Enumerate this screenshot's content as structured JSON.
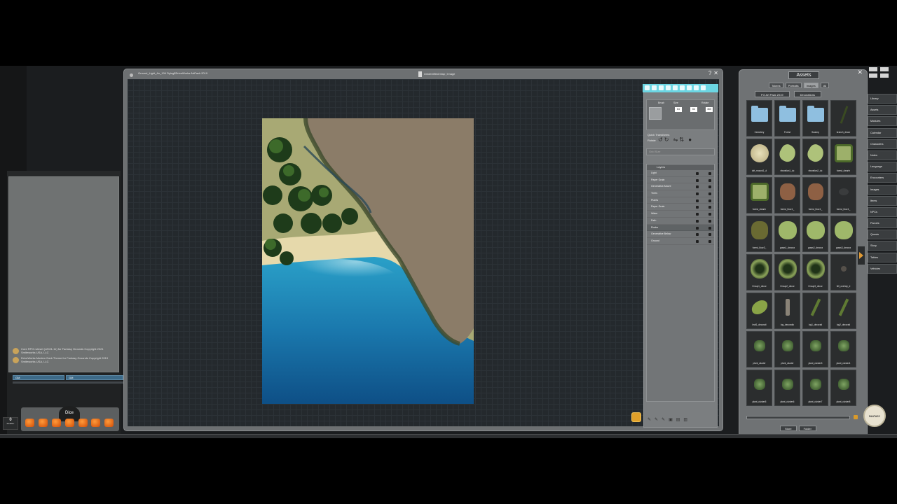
{
  "image_window": {
    "path": "Ground_Light_Ax_104 Dying$DriveWorks ArtPack 2019",
    "name": "Unidentified Map | Image",
    "buttons": [
      "?",
      "✕"
    ]
  },
  "chat": {
    "messages": [
      "Core RPG ruleset (v2021-11) for Fantasy Grounds Copyright 2021 Smiteworks USA, LLC",
      "DriveWorks Modern Dark Theme for Fantasy Grounds Copyright 2019 Smiteworks USA, LLC"
    ],
    "input_left": "GM",
    "input_right": "GM"
  },
  "modifier": {
    "value": "0",
    "label": "Modifier"
  },
  "dice_logo": "Dice",
  "tools": {
    "brush_label": "Brush",
    "size_label": "Size",
    "rotate_label": "Rotate",
    "size_value": "64",
    "size_value2": "64",
    "rotate_value": "360",
    "quick_transforms": "Quick Transforms",
    "rotate_row": "Rotate",
    "flip_label": "Flip",
    "reset_label": "Reset",
    "search_placeholder": "Grid Size",
    "layers_title": "Layers"
  },
  "layers": [
    {
      "name": "Light",
      "selected": false
    },
    {
      "name": "Paper Grain",
      "selected": false
    },
    {
      "name": "Generative Above",
      "selected": false
    },
    {
      "name": "Trees",
      "selected": false
    },
    {
      "name": "Plants",
      "selected": false
    },
    {
      "name": "Paper Grain",
      "selected": false
    },
    {
      "name": "Water",
      "selected": false
    },
    {
      "name": "Path",
      "selected": false
    },
    {
      "name": "Rocks",
      "selected": true
    },
    {
      "name": "Generative Below",
      "selected": false
    },
    {
      "name": "Ground",
      "selected": false
    }
  ],
  "assets": {
    "title": "Assets",
    "tabs": [
      "Tokens",
      "Portraits",
      "Images",
      "All"
    ],
    "active_tab": "Images",
    "subtabs": [
      "FG Art Pack 2019",
      "Decorations"
    ],
    "items": [
      {
        "label": "Cemetery",
        "kind": "folder"
      },
      {
        "label": "Forest",
        "kind": "folder"
      },
      {
        "label": "Swamp",
        "kind": "folder"
      },
      {
        "label": "branch_decor",
        "kind": "branch"
      },
      {
        "label": "dirt_mound1_d",
        "kind": "disc"
      },
      {
        "label": "elevation1_dc",
        "kind": "leafy"
      },
      {
        "label": "elevation2_dc",
        "kind": "leafy"
      },
      {
        "label": "forest_clearin",
        "kind": "clearing"
      },
      {
        "label": "forest_clearin",
        "kind": "clearing"
      },
      {
        "label": "forest_floor1_",
        "kind": "floor"
      },
      {
        "label": "forest_floor1_",
        "kind": "floor"
      },
      {
        "label": "forest_floor1_",
        "kind": "floor-dark"
      },
      {
        "label": "forest_floor3_",
        "kind": "moss-dark"
      },
      {
        "label": "grass1_decora",
        "kind": "grass"
      },
      {
        "label": "grass2_decora",
        "kind": "grass"
      },
      {
        "label": "grass3_decora",
        "kind": "grass"
      },
      {
        "label": "Group1_decor",
        "kind": "group"
      },
      {
        "label": "Group2_decor",
        "kind": "group"
      },
      {
        "label": "Group3_decor",
        "kind": "group"
      },
      {
        "label": "hill_overlay_d",
        "kind": "hill"
      },
      {
        "label": "leaf1_decorati",
        "kind": "leaf"
      },
      {
        "label": "log_decoratio",
        "kind": "log"
      },
      {
        "label": "log1_decorati",
        "kind": "twig"
      },
      {
        "label": "log2_decorati",
        "kind": "twig"
      },
      {
        "label": "plant_cluster",
        "kind": "plant"
      },
      {
        "label": "plant_cluster",
        "kind": "plant"
      },
      {
        "label": "plant_cluster3",
        "kind": "plant"
      },
      {
        "label": "plant_cluster4",
        "kind": "plant"
      },
      {
        "label": "plant_cluster5",
        "kind": "plant"
      },
      {
        "label": "plant_cluster6",
        "kind": "plant"
      },
      {
        "label": "plant_cluster7",
        "kind": "plant"
      },
      {
        "label": "plant_cluster8",
        "kind": "plant"
      }
    ],
    "bottom_buttons": [
      "Store",
      "Folder"
    ]
  },
  "sidebar": [
    "Library",
    "Assets",
    "Modules",
    "Calendar",
    "Characters",
    "Notes",
    "Language",
    "Encounters",
    "Images",
    "Items",
    "NPCs",
    "Parcels",
    "Quests",
    "Story",
    "Tables",
    "Vehicles"
  ],
  "fg_logo": "FANTASY GROUNDS",
  "colors": {
    "water": "#1a6fa0",
    "sand": "#e8dcb0",
    "cliff": "#8a7a66",
    "grass": "#a6a870",
    "accent_cyan": "#6cd6e3",
    "accent_orange": "#e09a35"
  }
}
